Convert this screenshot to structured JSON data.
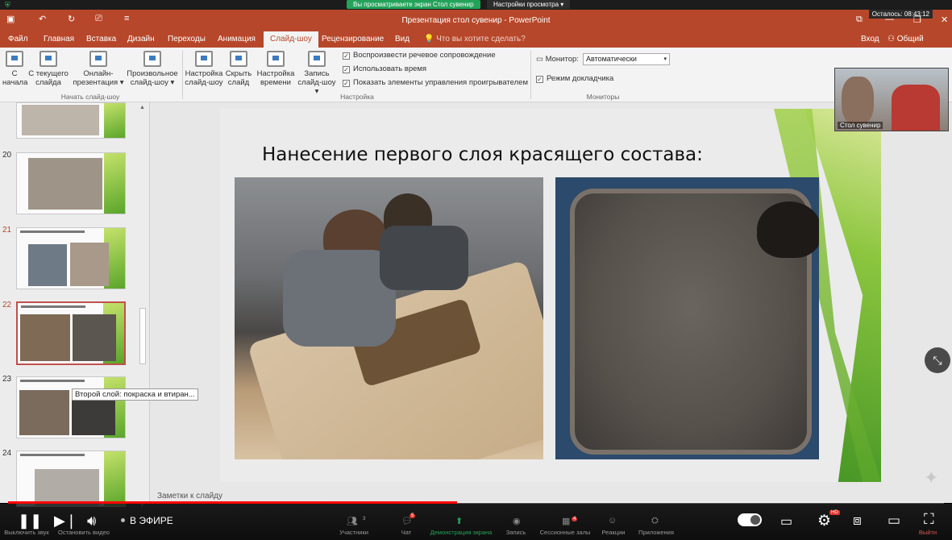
{
  "zoom_top": {
    "share_banner": "Вы просматриваете экран Стол сувенир",
    "view_options": "Настройки просмотра ▾",
    "remaining": "Осталось: 08:43:12",
    "view_right": "Вид"
  },
  "ppt": {
    "window_title": "Презентация стол сувенир - PowerPoint",
    "tabs": [
      "Файл",
      "Главная",
      "Вставка",
      "Дизайн",
      "Переходы",
      "Анимация",
      "Слайд-шоу",
      "Рецензирование",
      "Вид"
    ],
    "active_tab": "Слайд-шоу",
    "tell_me": "Что вы хотите сделать?",
    "sign_in": "Вход",
    "share": "Общий доступ"
  },
  "ribbon": {
    "start_group": {
      "label": "Начать слайд-шоу",
      "buttons": [
        {
          "line1": "С",
          "line2": "начала"
        },
        {
          "line1": "С текущего",
          "line2": "слайда"
        },
        {
          "line1": "Онлайн-",
          "line2": "презентация ▾"
        },
        {
          "line1": "Произвольное",
          "line2": "слайд-шоу ▾"
        }
      ]
    },
    "setup_group": {
      "label": "Настройка",
      "buttons": [
        {
          "line1": "Настройка",
          "line2": "слайд-шоу"
        },
        {
          "line1": "Скрыть",
          "line2": "слайд"
        },
        {
          "line1": "Настройка",
          "line2": "времени"
        },
        {
          "line1": "Запись",
          "line2": "слайд-шоу ▾"
        }
      ],
      "checkboxes": [
        "Воспроизвести речевое сопровождение",
        "Использовать время",
        "Показать элементы управления проигрывателем"
      ]
    },
    "monitors_group": {
      "label": "Мониторы",
      "monitor_label": "Монитор:",
      "monitor_value": "Автоматически",
      "presenter_view": "Режим докладчика"
    }
  },
  "thumbnails": {
    "numbers": [
      "20",
      "21",
      "22",
      "23",
      "24"
    ],
    "selected": "22",
    "tooltip": "Второй слой: покраска и втиран..."
  },
  "slide": {
    "title": "Нанесение первого слоя красящего состава:"
  },
  "notes_placeholder": "Заметки к слайду",
  "webcam": {
    "name": "Стол сувенир"
  },
  "player": {
    "live_label": "В ЭФИРЕ",
    "progress": 0.48,
    "hd_badge": "HD"
  },
  "zoom_controls": {
    "mute": "Выключить звук",
    "stop_video": "Остановить видео",
    "participants": "Участники",
    "participants_count": "3",
    "chat": "Чат",
    "chat_badge": "5",
    "share_screen": "Демонстрация экрана",
    "record": "Запись",
    "breakout": "Сессионные залы",
    "breakout_badge": "4",
    "reactions": "Реакции",
    "apps": "Приложения",
    "leave": "Выйти"
  },
  "colors": {
    "ppt_accent": "#b7472a",
    "progress": "#ff0000",
    "share_green": "#23a35a"
  }
}
